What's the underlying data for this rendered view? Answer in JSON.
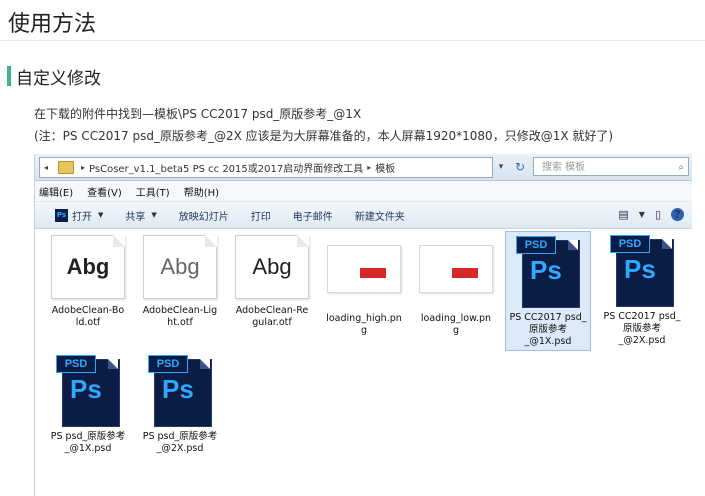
{
  "page": {
    "title": "使用方法",
    "section": "自定义修改",
    "para1": "在下载的附件中找到—模板\\PS CC2017 psd_原版参考_@1X",
    "para2": "(注：PS CC2017 psd_原版参考_@2X 应该是为大屏幕准备的，本人屏幕1920*1080，只修改@1X 就好了)"
  },
  "explorer": {
    "address": {
      "back_arrow": "◂",
      "crumbs": [
        "PsCoser_v1.1_beta5 PS cc 2015或2017启动界面修改工具",
        "模板"
      ],
      "separator": "▸",
      "dropdown": "▾",
      "refresh": "↻"
    },
    "search_placeholder": "搜索 模板",
    "menu": [
      "编辑(E)",
      "查看(V)",
      "工具(T)",
      "帮助(H)"
    ],
    "toolbar": {
      "open": "打开",
      "share": "共享",
      "slideshow": "放映幻灯片",
      "print": "打印",
      "email": "电子邮件",
      "new_folder": "新建文件夹",
      "dropdown_glyph": "▼"
    },
    "files": [
      {
        "name": "AdobeClean-Bold.otf",
        "label_lines": [
          "AdobeClean-Bo",
          "ld.otf"
        ],
        "kind": "font",
        "preview": "Abg",
        "weight": "bold",
        "selected": false
      },
      {
        "name": "AdobeClean-Light.otf",
        "label_lines": [
          "AdobeClean-Lig",
          "ht.otf"
        ],
        "kind": "font",
        "preview": "Abg",
        "weight": "light",
        "selected": false
      },
      {
        "name": "AdobeClean-Regular.otf",
        "label_lines": [
          "AdobeClean-Re",
          "gular.otf"
        ],
        "kind": "font",
        "preview": "Abg",
        "weight": "regular",
        "selected": false
      },
      {
        "name": "loading_high.png",
        "label_lines": [
          "loading_high.pn",
          "g"
        ],
        "kind": "png",
        "selected": false
      },
      {
        "name": "loading_low.png",
        "label_lines": [
          "loading_low.pn",
          "g"
        ],
        "kind": "png",
        "selected": false
      },
      {
        "name": "PS CC2017 psd_原版参考_@1X.psd",
        "label_lines": [
          "PS CC2017 psd_",
          "原版参考",
          "_@1X.psd"
        ],
        "kind": "psd",
        "selected": true
      },
      {
        "name": "PS CC2017 psd_原版参考_@2X.psd",
        "label_lines": [
          "PS CC2017 psd_",
          "原版参考",
          "_@2X.psd"
        ],
        "kind": "psd",
        "selected": false
      },
      {
        "name": "PS psd_原版参考_@1X.psd",
        "label_lines": [
          "PS psd_原版参考",
          "_@1X.psd"
        ],
        "kind": "psd",
        "selected": false
      },
      {
        "name": "PS psd_原版参考_@2X.psd",
        "label_lines": [
          "PS psd_原版参考",
          "_@2X.psd"
        ],
        "kind": "psd",
        "selected": false
      }
    ],
    "psd_badge": "PSD",
    "ps_logo": "Ps",
    "icons": {
      "folder": "folder-icon",
      "search": "search-icon",
      "help": "help-icon"
    },
    "colors": {
      "accent_bar": "#3eb28a",
      "selection": "#dbe9f9",
      "ps_blue": "#31a8ff",
      "ps_dark": "#0b1d45"
    }
  }
}
